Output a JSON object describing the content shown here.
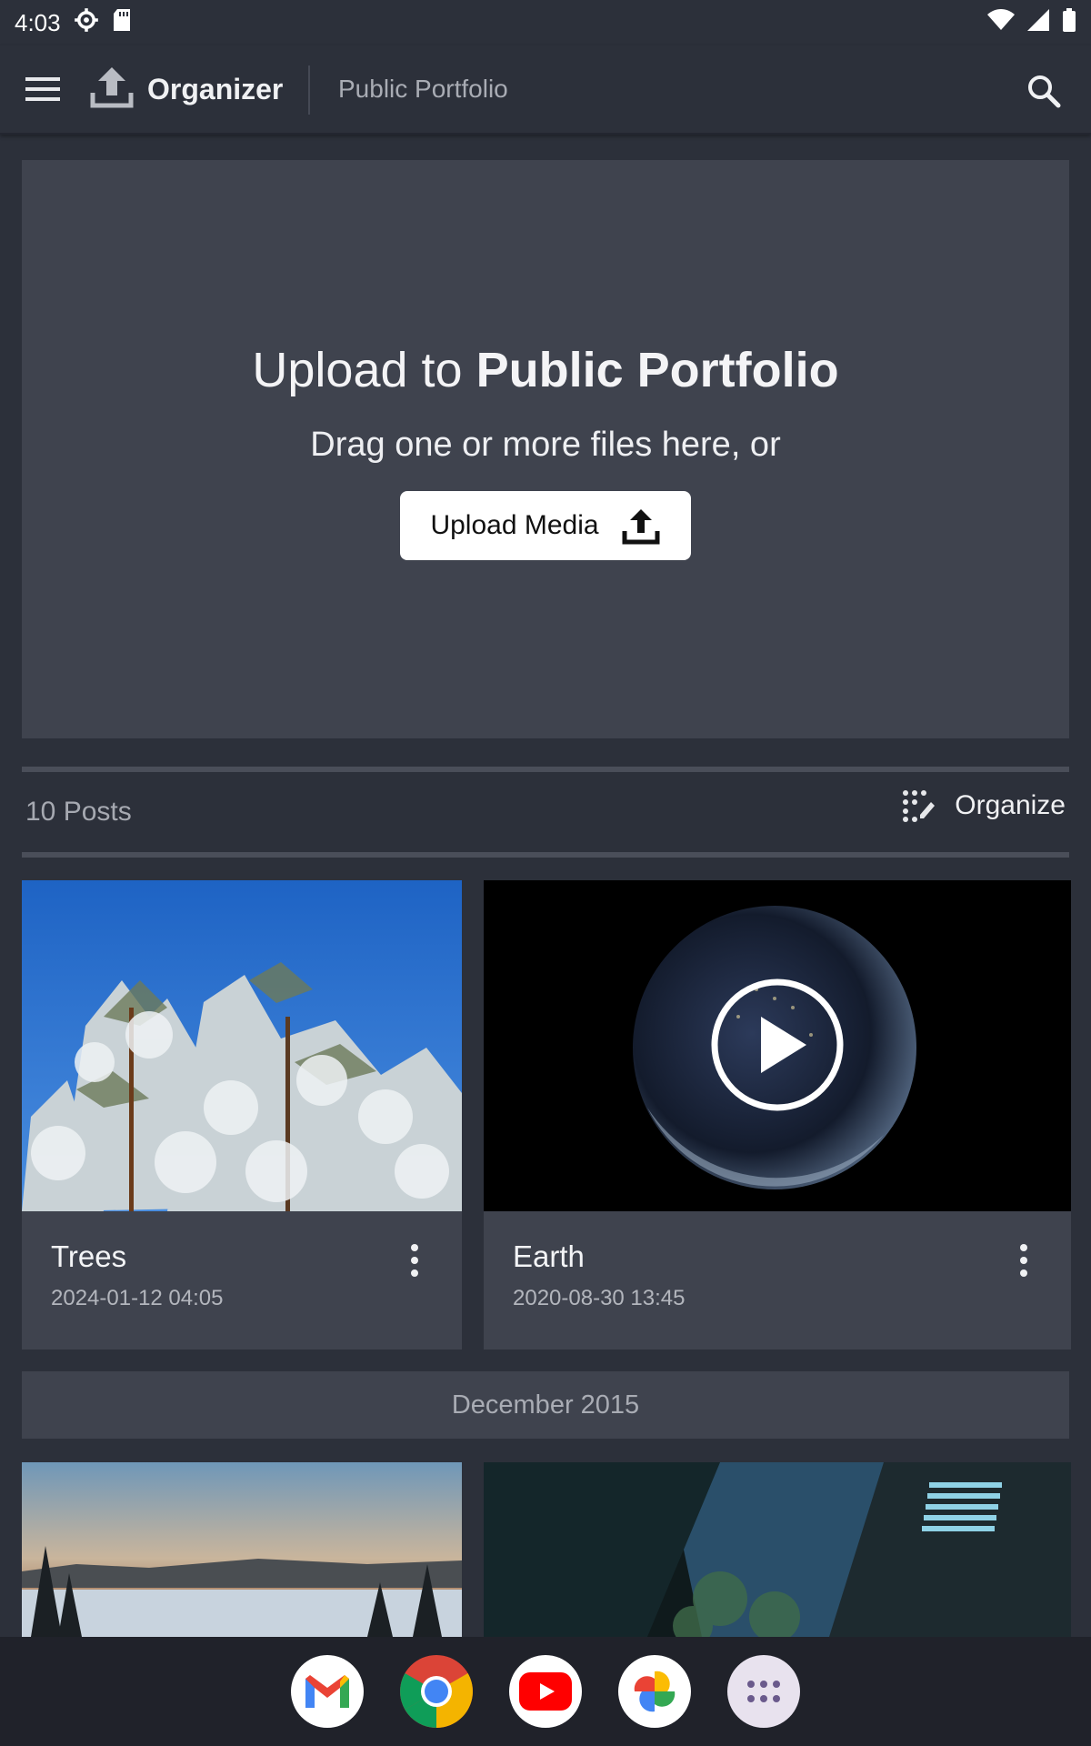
{
  "status_bar": {
    "time": "4:03",
    "icons": [
      "settings-gear-icon",
      "sd-card-icon",
      "wifi-icon",
      "cell-signal-icon",
      "battery-icon"
    ]
  },
  "app_bar": {
    "app_name": "Organizer",
    "breadcrumb": "Public Portfolio"
  },
  "upload": {
    "title_prefix": "Upload to",
    "title_target": "Public Portfolio",
    "subtitle": "Drag one or more files here, or",
    "button_label": "Upload Media"
  },
  "posts_header": {
    "count_label": "10 Posts",
    "organize_label": "Organize"
  },
  "posts": [
    {
      "title": "Trees",
      "date": "2024-01-12 04:05",
      "kind": "image"
    },
    {
      "title": "Earth",
      "date": "2020-08-30 13:45",
      "kind": "video"
    }
  ],
  "section": {
    "month_label": "December 2015"
  },
  "dock": {
    "apps": [
      "gmail-icon",
      "chrome-icon",
      "youtube-icon",
      "google-photos-icon",
      "app-drawer-icon"
    ]
  },
  "colors": {
    "background": "#2c303a",
    "surface": "#3f434e",
    "text_muted": "#a9acb4",
    "button_bg": "#ffffff"
  }
}
